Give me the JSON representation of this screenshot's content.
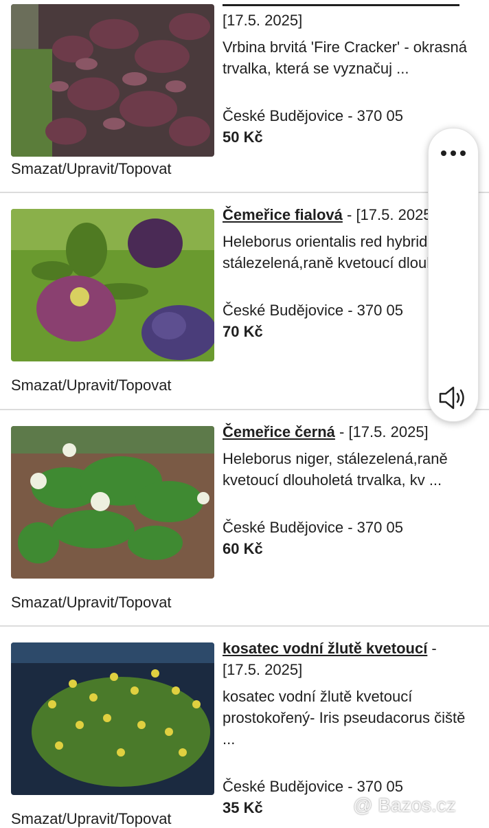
{
  "listings": [
    {
      "title": "",
      "date": "[17.5. 2025]",
      "description": "Vrbina brvitá 'Fire Cracker' - okrasná trvalka, která se vyznačuj ...",
      "location": "České Budějovice - 370 05",
      "price": "50 Kč",
      "actions": "Smazat/Upravit/Topovat"
    },
    {
      "title": "Čemeřice fialová",
      "separator": " - ",
      "date": "[17.5. 2025]",
      "description": "Heleborus orientalis red hybrid stálezelená,raně kvetoucí dlouholetá",
      "location": "České Budějovice - 370 05",
      "price": "70 Kč",
      "actions": "Smazat/Upravit/Topovat"
    },
    {
      "title": "Čemeřice černá",
      "separator": " - ",
      "date": "[17.5. 2025]",
      "description": "Heleborus niger, stálezelená,raně kvetoucí dlouholetá trvalka, kv ...",
      "location": "České Budějovice - 370 05",
      "price": "60 Kč",
      "actions": "Smazat/Upravit/Topovat"
    },
    {
      "title": "kosatec vodní žlutě kvetoucí",
      "separator": " -",
      "date": "[17.5. 2025]",
      "description": "kosatec vodní žlutě kvetoucí prostokořený- Iris pseudacorus čiště ...",
      "location": "České Budějovice - 370 05",
      "price": "35 Kč",
      "actions": "Smazat/Upravit/Topovat"
    }
  ],
  "panel": {
    "menu_icon": "more-dots-icon",
    "speaker_icon": "speaker-icon"
  },
  "watermark": "@ Bazos.cz",
  "colors": {
    "divider": "#dcdcdc",
    "text": "#1f1f1f"
  }
}
